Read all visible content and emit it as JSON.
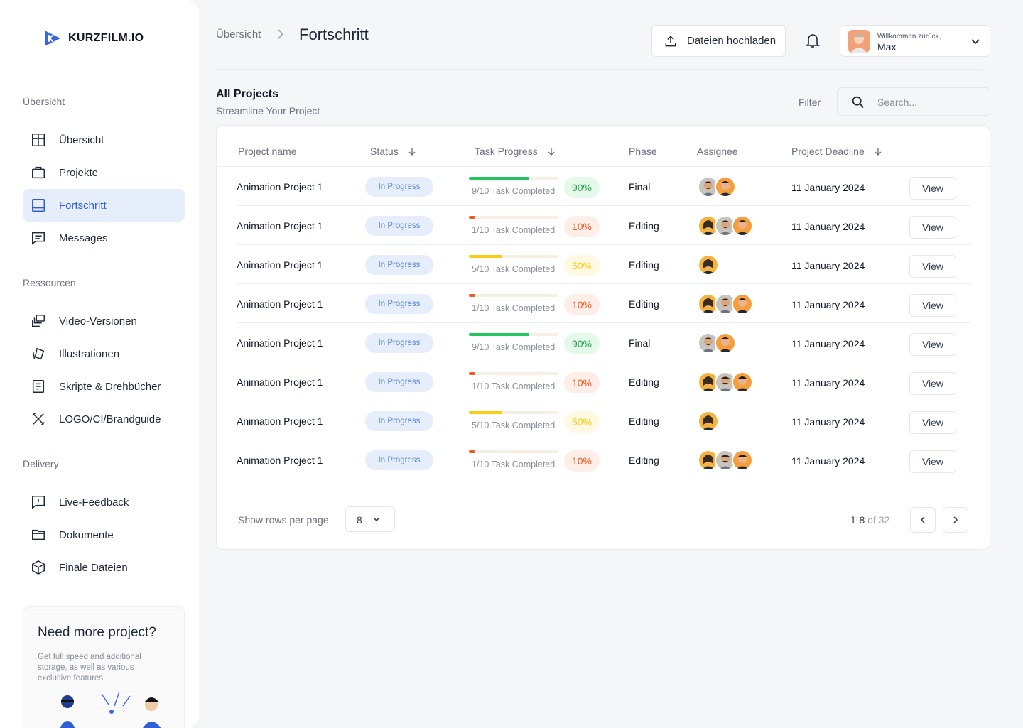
{
  "brand": {
    "name": "KURZFILM.IO",
    "accent": "#2f5fd0"
  },
  "sidebar": {
    "sections": [
      {
        "label": "Übersicht"
      },
      {
        "label": "Ressourcen"
      },
      {
        "label": "Delivery"
      }
    ],
    "items": [
      {
        "label": "Übersicht",
        "icon": "layout-icon"
      },
      {
        "label": "Projekte",
        "icon": "briefcase-icon"
      },
      {
        "label": "Fortschritt",
        "icon": "progress-icon",
        "active": true
      },
      {
        "label": "Messages",
        "icon": "message-icon"
      },
      {
        "label": "Video-Versionen",
        "icon": "video-versions-icon"
      },
      {
        "label": "Illustrationen",
        "icon": "illustration-icon"
      },
      {
        "label": "Skripte & Drehbücher",
        "icon": "script-icon"
      },
      {
        "label": "LOGO/CI/Brandguide",
        "icon": "tools-icon"
      },
      {
        "label": "Live-Feedback",
        "icon": "feedback-icon"
      },
      {
        "label": "Dokumente",
        "icon": "folder-icon"
      },
      {
        "label": "Finale Dateien",
        "icon": "package-icon"
      }
    ],
    "promo": {
      "title": "Need more project?",
      "text": "Get full speed and additional storage, as well as various exclusive features."
    }
  },
  "header": {
    "breadcrumb_root": "Übersicht",
    "breadcrumb_current": "Fortschritt",
    "upload_label": "Dateien hochladen",
    "welcome": "Willkommen zurück,",
    "user_name": "Max"
  },
  "projects": {
    "title": "All Projects",
    "subtitle": "Streamline Your Project",
    "filter_label": "Filter",
    "search_placeholder": "Search...",
    "columns": {
      "name": "Project name",
      "status": "Status",
      "progress": "Task Progress",
      "phase": "Phase",
      "assignee": "Assignee",
      "deadline": "Project Deadline"
    },
    "rows": [
      {
        "name": "Animation Project 1",
        "status": "In Progress",
        "progress": 0.9,
        "task": "9/10 Task Completed",
        "pct": "90%",
        "phase": "Final",
        "assignees": 2,
        "deadline": "11 January 2024",
        "view": "View"
      },
      {
        "name": "Animation Project 1",
        "status": "In Progress",
        "progress": 0.1,
        "task": "1/10 Task Completed",
        "pct": "10%",
        "phase": "Editing",
        "assignees": 3,
        "deadline": "11 January 2024",
        "view": "View"
      },
      {
        "name": "Animation Project 1",
        "status": "In Progress",
        "progress": 0.5,
        "task": "5/10 Task Completed",
        "pct": "50%",
        "phase": "Editing",
        "assignees": 1,
        "deadline": "11 January 2024",
        "view": "View"
      },
      {
        "name": "Animation Project 1",
        "status": "In Progress",
        "progress": 0.1,
        "task": "1/10 Task Completed",
        "pct": "10%",
        "phase": "Editing",
        "assignees": 3,
        "deadline": "11 January 2024",
        "view": "View"
      },
      {
        "name": "Animation Project 1",
        "status": "In Progress",
        "progress": 0.9,
        "task": "9/10 Task Completed",
        "pct": "90%",
        "phase": "Final",
        "assignees": 2,
        "deadline": "11 January 2024",
        "view": "View"
      },
      {
        "name": "Animation Project 1",
        "status": "In Progress",
        "progress": 0.1,
        "task": "1/10 Task Completed",
        "pct": "10%",
        "phase": "Editing",
        "assignees": 3,
        "deadline": "11 January 2024",
        "view": "View"
      },
      {
        "name": "Animation Project 1",
        "status": "In Progress",
        "progress": 0.5,
        "task": "5/10 Task Completed",
        "pct": "50%",
        "phase": "Editing",
        "assignees": 1,
        "deadline": "11 January 2024",
        "view": "View"
      },
      {
        "name": "Animation Project 1",
        "status": "In Progress",
        "progress": 0.1,
        "task": "1/10 Task Completed",
        "pct": "10%",
        "phase": "Editing",
        "assignees": 3,
        "deadline": "11 January 2024",
        "view": "View"
      }
    ],
    "footer": {
      "rows_label": "Show rows per page",
      "rows_value": "8",
      "range": "1-8",
      "of_total": "of 32"
    }
  },
  "colors": {
    "high": "#22c55e",
    "mid": "#facc15",
    "low": "#ef5a1f",
    "status_bg": "#e6eefc"
  }
}
